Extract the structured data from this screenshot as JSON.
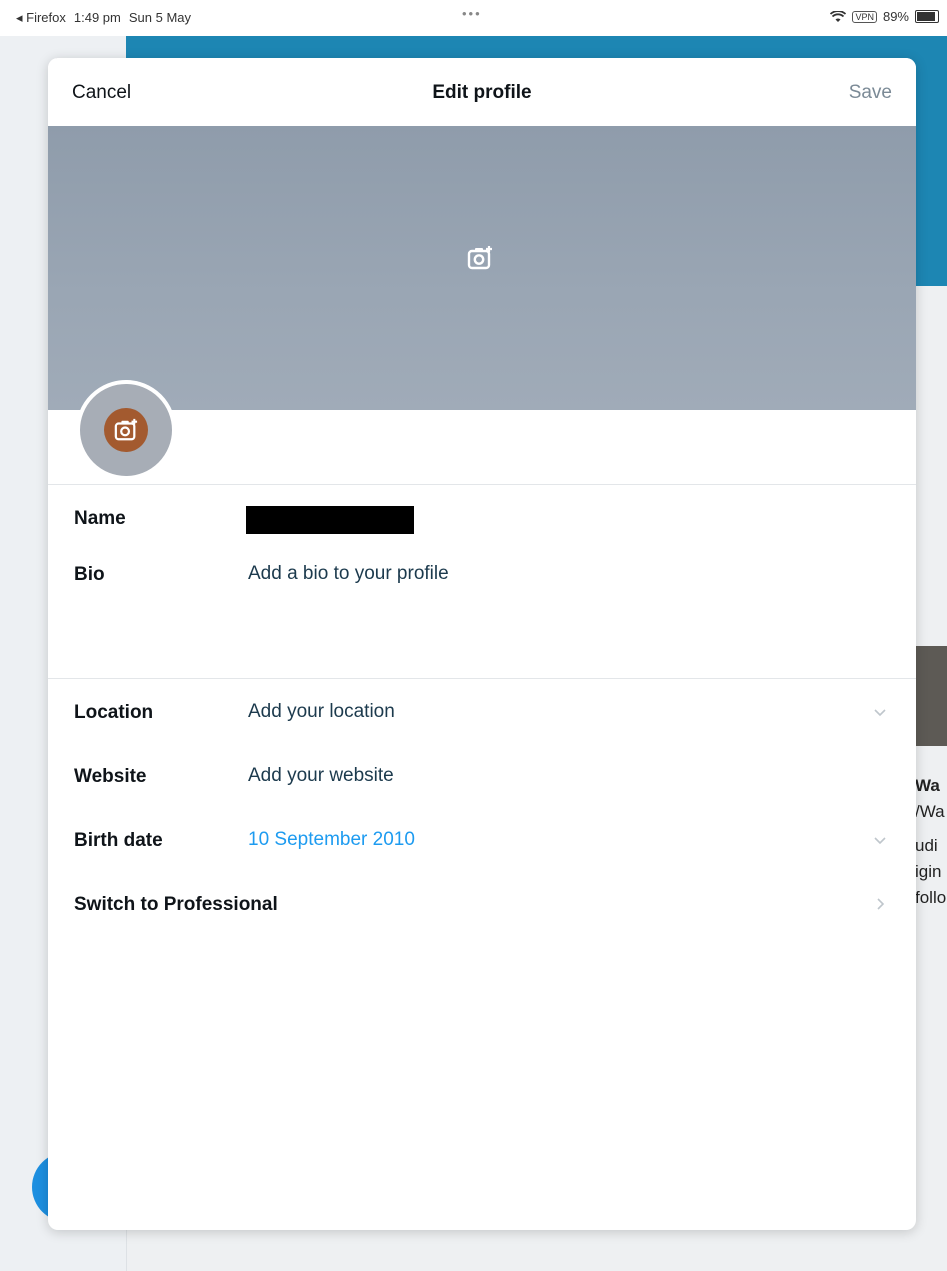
{
  "status_bar": {
    "app": "◂ Firefox",
    "time": "1:49 pm",
    "date": "Sun 5 May",
    "dots": "•••",
    "vpn": "VPN",
    "battery": "89%",
    "battery_level": 0.89
  },
  "header": {
    "cancel_label": "Cancel",
    "title": "Edit profile",
    "save_label": "Save"
  },
  "icons": {
    "banner_camera": "camera-add-icon",
    "avatar_camera": "camera-add-icon",
    "chevron_down": "chevron-down-icon",
    "chevron_right": "chevron-right-icon"
  },
  "fields": {
    "name": {
      "label": "Name",
      "value": ""
    },
    "bio": {
      "label": "Bio",
      "placeholder": "Add a bio to your profile"
    },
    "location": {
      "label": "Location",
      "placeholder": "Add your location"
    },
    "website": {
      "label": "Website",
      "placeholder": "Add your website"
    },
    "birth_date": {
      "label": "Birth date",
      "value": "10 September 2010"
    },
    "professional": {
      "label": "Switch to Professional"
    }
  },
  "background": {
    "side_text": [
      "Wa",
      "/Wa",
      "udi",
      "igin",
      "follo"
    ]
  },
  "colors": {
    "accent": "#1d9bf0",
    "banner": "#9aa6b4",
    "avatar_camera_bg": "#a35a2f",
    "save_disabled": "#7b8a96"
  }
}
